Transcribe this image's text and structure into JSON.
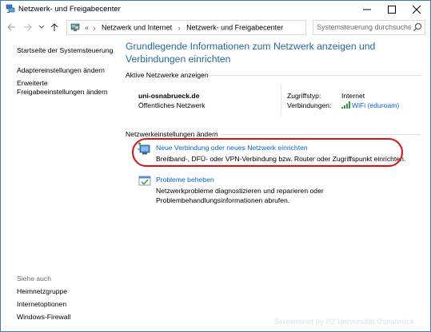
{
  "window": {
    "title": "Netzwerk- und Freigabecenter"
  },
  "address": {
    "overflow": "«",
    "crumbs": [
      "Netzwerk und Internet",
      "Netzwerk- und Freigabecenter"
    ],
    "separator": "›",
    "search_placeholder": "Systemsteuerung durchsuchen"
  },
  "sidebar": {
    "links": [
      "Startseite der Systemsteuerung",
      "Adaptereinstellungen ändern",
      "Erweiterte\nFreigabeeinstellungen ändern"
    ],
    "see_also_heading": "Siehe auch",
    "see_also": [
      "Heimnetzgruppe",
      "Internetoptionen",
      "Windows-Firewall"
    ]
  },
  "main": {
    "title": "Grundlegende Informationen zum Netzwerk anzeigen und Verbindungen einrichten",
    "active_networks_heading": "Aktive Netzwerke anzeigen",
    "network": {
      "name": "uni-osnabrueck.de",
      "type": "Öffentliches Netzwerk",
      "access_label": "Zugriffstyp:",
      "access_value": "Internet",
      "connections_label": "Verbindungen:",
      "connections_value": "WiFi (eduroam)"
    },
    "change_settings_heading": "Netzwerkeinstellungen ändern",
    "tasks": [
      {
        "link": "Neue Verbindung oder neues Netzwerk einrichten",
        "description": "Breitband-, DFÜ- oder VPN-Verbindung bzw. Router oder Zugriffspunkt einrichten."
      },
      {
        "link": "Probleme beheben",
        "description": "Netzwerkprobleme diagnostizieren und reparieren oder Problembehandlungsinformationen abrufen."
      }
    ]
  },
  "watermark": "Screenshot by RZ Universität Osnabrück",
  "colors": {
    "link": "#0066cc",
    "title": "#26689e",
    "highlight": "#e01010",
    "window_border": "#3c7fb1"
  }
}
